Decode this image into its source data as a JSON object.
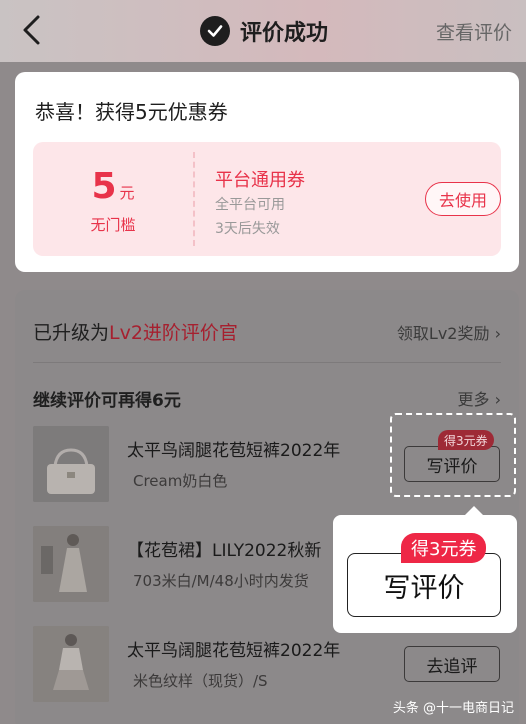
{
  "header": {
    "title": "评价成功",
    "view_review": "查看评价"
  },
  "coupon_card": {
    "congrats": "恭喜！获得5元优惠券",
    "amount": "5",
    "amount_unit": "元",
    "threshold": "无门槛",
    "name": "平台通用券",
    "scope": "全平台可用",
    "expiry": "3天后失效",
    "use_button": "去使用"
  },
  "level": {
    "prefix": "已升级为",
    "level_name": "Lv2进阶评价官",
    "claim_link": "领取Lv2奖励"
  },
  "continue": {
    "title": "继续评价可再得6元",
    "more": "更多"
  },
  "products": [
    {
      "title": "太平鸟阔腿花苞短裤2022年",
      "variant": "Cream奶白色",
      "badge": "得3元券",
      "button": "写评价"
    },
    {
      "title": "【花苞裙】LILY2022秋新",
      "variant": "703米白/M/48小时内发货"
    },
    {
      "title": "太平鸟阔腿花苞短裤2022年",
      "variant": "米色纹样（现货）/S",
      "button": "去追评"
    }
  ],
  "popup": {
    "badge": "得3元券",
    "button": "写评价"
  },
  "watermark": "头条 @十一电商日记",
  "colors": {
    "accent": "#e8334a",
    "badge_red": "#ee2746"
  }
}
